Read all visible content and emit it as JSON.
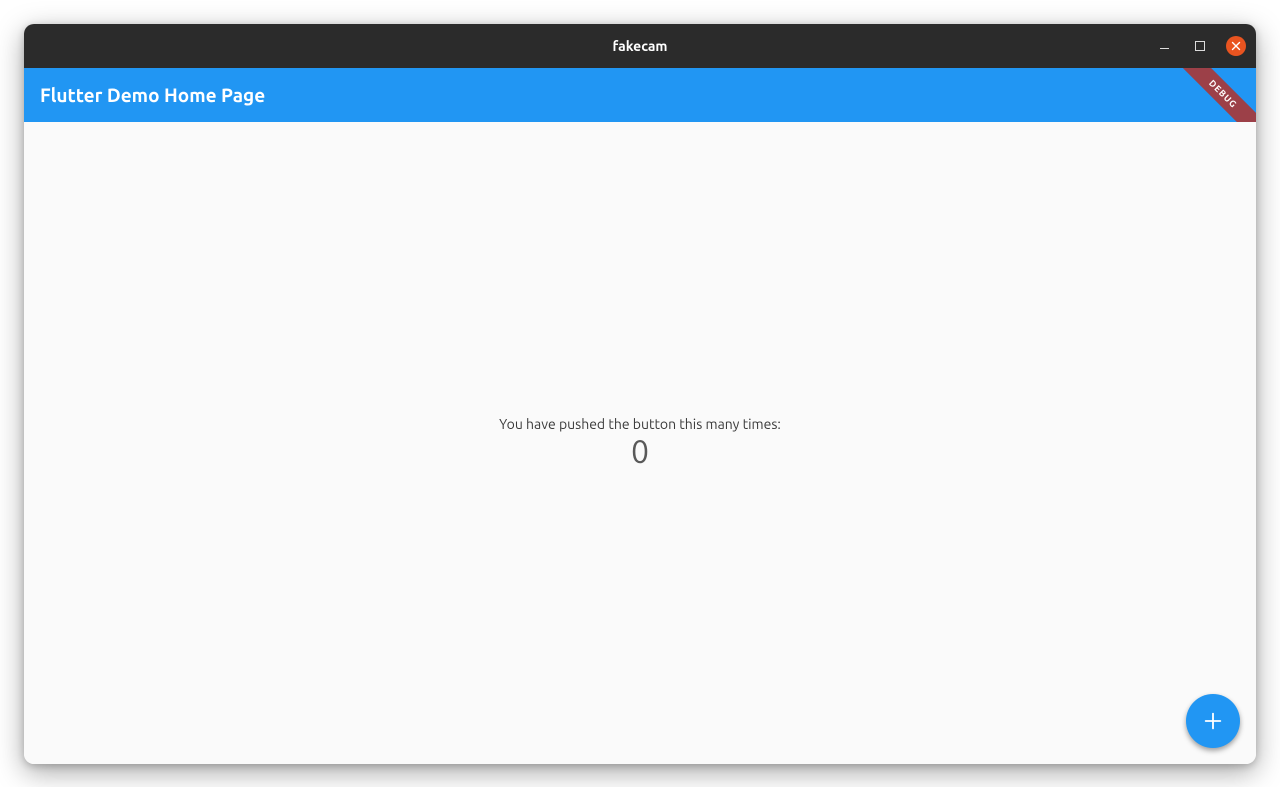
{
  "window": {
    "title": "fakecam"
  },
  "appbar": {
    "title": "Flutter Demo Home Page"
  },
  "debug_banner": {
    "label": "DEBUG"
  },
  "body": {
    "caption": "You have pushed the button this many times:",
    "counter_value": "0"
  },
  "fab": {
    "icon_name": "add-icon"
  },
  "colors": {
    "primary": "#2196f3",
    "titlebar_bg": "#2b2b2b",
    "close_btn": "#e95420",
    "debug_banner": "#9c4048",
    "surface": "#fafafa"
  }
}
